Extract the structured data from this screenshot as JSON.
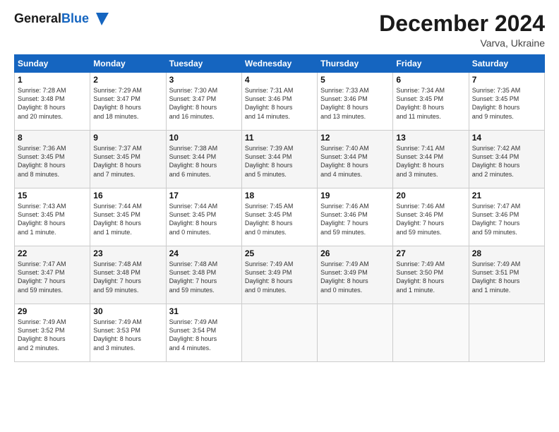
{
  "header": {
    "title": "December 2024",
    "location": "Varva, Ukraine",
    "logo_general": "General",
    "logo_blue": "Blue"
  },
  "calendar": {
    "headers": [
      "Sunday",
      "Monday",
      "Tuesday",
      "Wednesday",
      "Thursday",
      "Friday",
      "Saturday"
    ],
    "weeks": [
      [
        {
          "day": "",
          "info": ""
        },
        {
          "day": "2",
          "info": "Sunrise: 7:29 AM\nSunset: 3:47 PM\nDaylight: 8 hours\nand 18 minutes."
        },
        {
          "day": "3",
          "info": "Sunrise: 7:30 AM\nSunset: 3:47 PM\nDaylight: 8 hours\nand 16 minutes."
        },
        {
          "day": "4",
          "info": "Sunrise: 7:31 AM\nSunset: 3:46 PM\nDaylight: 8 hours\nand 14 minutes."
        },
        {
          "day": "5",
          "info": "Sunrise: 7:33 AM\nSunset: 3:46 PM\nDaylight: 8 hours\nand 13 minutes."
        },
        {
          "day": "6",
          "info": "Sunrise: 7:34 AM\nSunset: 3:45 PM\nDaylight: 8 hours\nand 11 minutes."
        },
        {
          "day": "7",
          "info": "Sunrise: 7:35 AM\nSunset: 3:45 PM\nDaylight: 8 hours\nand 9 minutes."
        }
      ],
      [
        {
          "day": "8",
          "info": "Sunrise: 7:36 AM\nSunset: 3:45 PM\nDaylight: 8 hours\nand 8 minutes."
        },
        {
          "day": "9",
          "info": "Sunrise: 7:37 AM\nSunset: 3:45 PM\nDaylight: 8 hours\nand 7 minutes."
        },
        {
          "day": "10",
          "info": "Sunrise: 7:38 AM\nSunset: 3:44 PM\nDaylight: 8 hours\nand 6 minutes."
        },
        {
          "day": "11",
          "info": "Sunrise: 7:39 AM\nSunset: 3:44 PM\nDaylight: 8 hours\nand 5 minutes."
        },
        {
          "day": "12",
          "info": "Sunrise: 7:40 AM\nSunset: 3:44 PM\nDaylight: 8 hours\nand 4 minutes."
        },
        {
          "day": "13",
          "info": "Sunrise: 7:41 AM\nSunset: 3:44 PM\nDaylight: 8 hours\nand 3 minutes."
        },
        {
          "day": "14",
          "info": "Sunrise: 7:42 AM\nSunset: 3:44 PM\nDaylight: 8 hours\nand 2 minutes."
        }
      ],
      [
        {
          "day": "15",
          "info": "Sunrise: 7:43 AM\nSunset: 3:45 PM\nDaylight: 8 hours\nand 1 minute."
        },
        {
          "day": "16",
          "info": "Sunrise: 7:44 AM\nSunset: 3:45 PM\nDaylight: 8 hours\nand 1 minute."
        },
        {
          "day": "17",
          "info": "Sunrise: 7:44 AM\nSunset: 3:45 PM\nDaylight: 8 hours\nand 0 minutes."
        },
        {
          "day": "18",
          "info": "Sunrise: 7:45 AM\nSunset: 3:45 PM\nDaylight: 8 hours\nand 0 minutes."
        },
        {
          "day": "19",
          "info": "Sunrise: 7:46 AM\nSunset: 3:46 PM\nDaylight: 7 hours\nand 59 minutes."
        },
        {
          "day": "20",
          "info": "Sunrise: 7:46 AM\nSunset: 3:46 PM\nDaylight: 7 hours\nand 59 minutes."
        },
        {
          "day": "21",
          "info": "Sunrise: 7:47 AM\nSunset: 3:46 PM\nDaylight: 7 hours\nand 59 minutes."
        }
      ],
      [
        {
          "day": "22",
          "info": "Sunrise: 7:47 AM\nSunset: 3:47 PM\nDaylight: 7 hours\nand 59 minutes."
        },
        {
          "day": "23",
          "info": "Sunrise: 7:48 AM\nSunset: 3:48 PM\nDaylight: 7 hours\nand 59 minutes."
        },
        {
          "day": "24",
          "info": "Sunrise: 7:48 AM\nSunset: 3:48 PM\nDaylight: 7 hours\nand 59 minutes."
        },
        {
          "day": "25",
          "info": "Sunrise: 7:49 AM\nSunset: 3:49 PM\nDaylight: 8 hours\nand 0 minutes."
        },
        {
          "day": "26",
          "info": "Sunrise: 7:49 AM\nSunset: 3:49 PM\nDaylight: 8 hours\nand 0 minutes."
        },
        {
          "day": "27",
          "info": "Sunrise: 7:49 AM\nSunset: 3:50 PM\nDaylight: 8 hours\nand 1 minute."
        },
        {
          "day": "28",
          "info": "Sunrise: 7:49 AM\nSunset: 3:51 PM\nDaylight: 8 hours\nand 1 minute."
        }
      ],
      [
        {
          "day": "29",
          "info": "Sunrise: 7:49 AM\nSunset: 3:52 PM\nDaylight: 8 hours\nand 2 minutes."
        },
        {
          "day": "30",
          "info": "Sunrise: 7:49 AM\nSunset: 3:53 PM\nDaylight: 8 hours\nand 3 minutes."
        },
        {
          "day": "31",
          "info": "Sunrise: 7:49 AM\nSunset: 3:54 PM\nDaylight: 8 hours\nand 4 minutes."
        },
        {
          "day": "",
          "info": ""
        },
        {
          "day": "",
          "info": ""
        },
        {
          "day": "",
          "info": ""
        },
        {
          "day": "",
          "info": ""
        }
      ]
    ],
    "week0_day1": {
      "day": "1",
      "info": "Sunrise: 7:28 AM\nSunset: 3:48 PM\nDaylight: 8 hours\nand 20 minutes."
    }
  }
}
